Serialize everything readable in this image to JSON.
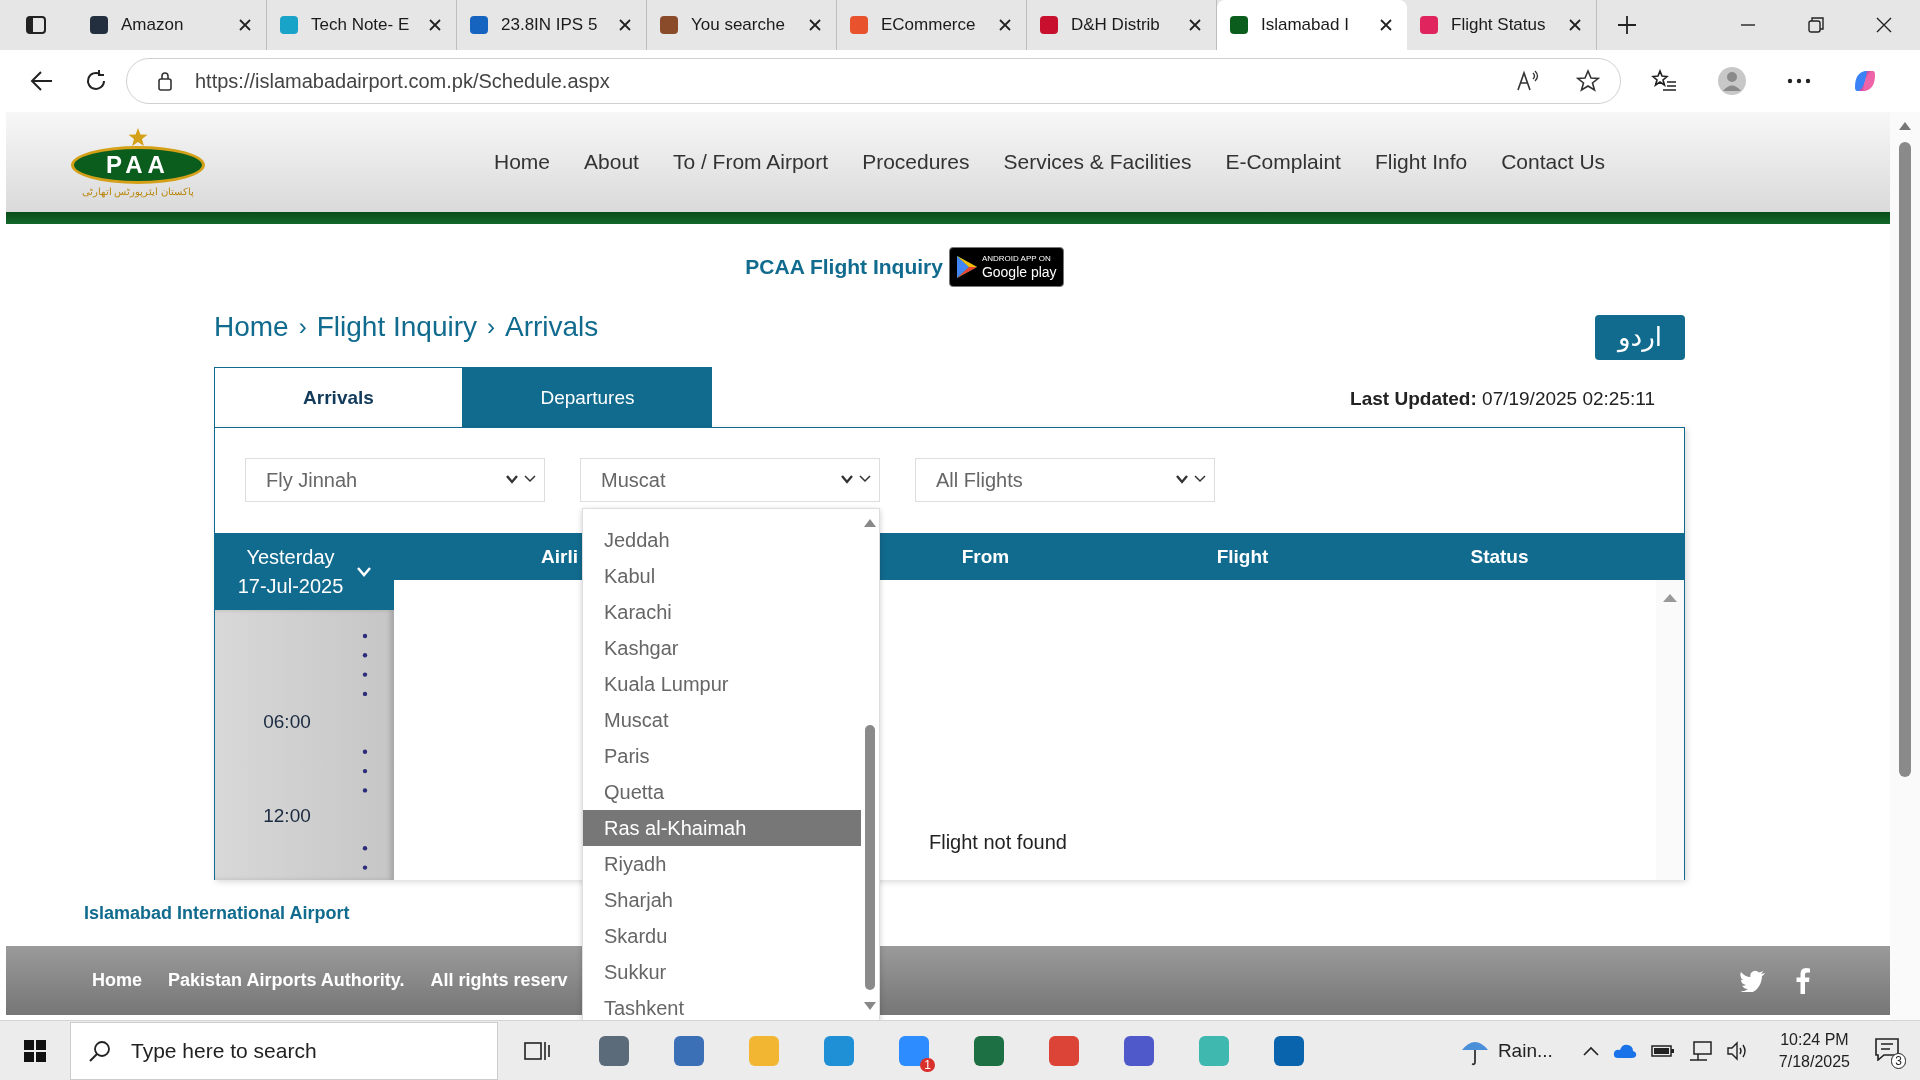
{
  "browser": {
    "tabs": [
      {
        "label": "Amazon",
        "color": "#232f3e",
        "selected": false
      },
      {
        "label": "Tech Note- E",
        "color": "#1aa3c8",
        "selected": false
      },
      {
        "label": "23.8IN IPS 5",
        "color": "#1565c0",
        "selected": false
      },
      {
        "label": "You searche",
        "color": "#8a4b2a",
        "selected": false
      },
      {
        "label": "ECommerce",
        "color": "#e8522c",
        "selected": false
      },
      {
        "label": "D&H Distrib",
        "color": "#c8102e",
        "selected": false
      },
      {
        "label": "Islamabad I",
        "color": "#0b5d1e",
        "selected": true
      },
      {
        "label": "Flight Status",
        "color": "#e0245e",
        "selected": false
      }
    ],
    "url": "https://islamabadairport.com.pk/Schedule.aspx"
  },
  "site": {
    "logo": {
      "mark": "PAA",
      "subtitle": "پاکستان ایئرپورٹس اتھارٹی"
    },
    "nav": [
      "Home",
      "About",
      "To / From Airport",
      "Procedures",
      "Services & Facilities",
      "E-Complaint",
      "Flight Info",
      "Contact Us"
    ]
  },
  "promo": {
    "title": "PCAA Flight Inquiry",
    "badge_caption": "ANDROID APP ON",
    "badge_label": "Google play"
  },
  "breadcrumb": {
    "items": [
      "Home",
      "Flight Inquiry",
      "Arrivals"
    ],
    "separator": "›"
  },
  "language_button": "اردو",
  "view_tabs": [
    {
      "label": "Arrivals",
      "selected": true
    },
    {
      "label": "Departures",
      "selected": false
    }
  ],
  "last_updated": {
    "label": "Last Updated:",
    "value": "07/19/2025 02:25:11"
  },
  "filters": [
    {
      "value": "Fly Jinnah"
    },
    {
      "value": "Muscat",
      "options": [
        {
          "label": "Jeddah",
          "highlighted": false
        },
        {
          "label": "Kabul",
          "highlighted": false
        },
        {
          "label": "Karachi",
          "highlighted": false
        },
        {
          "label": "Kashgar",
          "highlighted": false
        },
        {
          "label": "Kuala Lumpur",
          "highlighted": false
        },
        {
          "label": "Muscat",
          "highlighted": false
        },
        {
          "label": "Paris",
          "highlighted": false
        },
        {
          "label": "Quetta",
          "highlighted": false
        },
        {
          "label": "Ras al-Khaimah",
          "highlighted": true
        },
        {
          "label": "Riyadh",
          "highlighted": false
        },
        {
          "label": "Sharjah",
          "highlighted": false
        },
        {
          "label": "Skardu",
          "highlighted": false
        },
        {
          "label": "Sukkur",
          "highlighted": false
        },
        {
          "label": "Tashkent",
          "highlighted": false
        }
      ]
    },
    {
      "value": "All Flights"
    }
  ],
  "date_panel": {
    "day": "Yesterday",
    "date": "17-Jul-2025",
    "times": [
      "06:00",
      "12:00"
    ]
  },
  "table": {
    "columns": [
      "Airli",
      "From",
      "Flight",
      "Status"
    ],
    "empty_message": "Flight not found"
  },
  "footer": {
    "airport_name": "Islamabad International Airport",
    "links": [
      "Home",
      "Pakistan Airports Authority.",
      "All rights reserv"
    ]
  },
  "taskbar": {
    "search_placeholder": "Type here to search",
    "apps": [
      {
        "color": "#5b6b7a"
      },
      {
        "color": "#3b6fb6"
      },
      {
        "color": "#f2b632"
      },
      {
        "color": "#1f8fd6"
      },
      {
        "color": "#2d8cff",
        "badge": "1"
      },
      {
        "color": "#1d7044"
      },
      {
        "color": "#db4437"
      },
      {
        "color": "#5059c9"
      },
      {
        "color": "#3fb8af"
      },
      {
        "color": "#0a64ad"
      }
    ],
    "weather": "Rain...",
    "time": "10:24 PM",
    "date": "7/18/2025",
    "notifications": "3"
  }
}
